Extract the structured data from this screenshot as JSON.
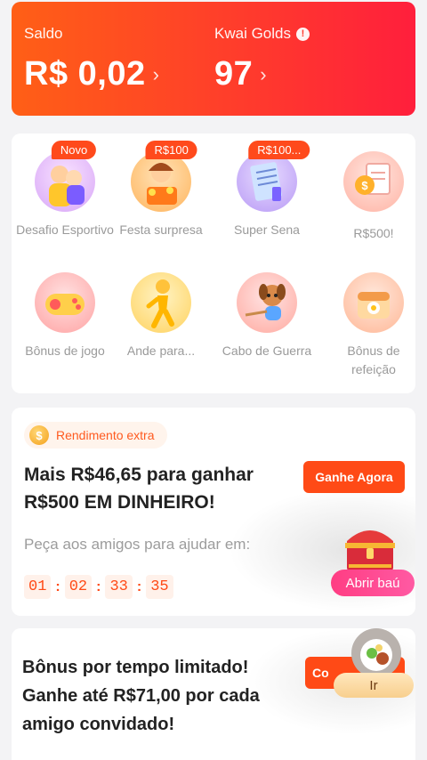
{
  "balance": {
    "saldo_label": "Saldo",
    "saldo_value": "R$ 0,02",
    "golds_label": "Kwai Golds",
    "golds_value": "97",
    "chevron": "›",
    "info_icon": "!"
  },
  "tiles": [
    {
      "badge": "Novo",
      "label": "Desafio Esportivo",
      "icon": "sport-challenge-icon"
    },
    {
      "badge": "R$100",
      "label": "Festa surpresa",
      "icon": "party-icon"
    },
    {
      "badge": "R$100...",
      "label": "Super Sena",
      "icon": "lottery-ticket-icon"
    },
    {
      "badge": "",
      "label": "R$500!",
      "icon": "coin-document-icon"
    },
    {
      "badge": "",
      "label": "Bônus de jogo",
      "icon": "gamepad-icon"
    },
    {
      "badge": "",
      "label": "Ande para...",
      "icon": "walking-person-icon"
    },
    {
      "badge": "",
      "label": "Cabo de Guerra",
      "icon": "tug-of-war-dog-icon"
    },
    {
      "badge": "",
      "label": "Bônus de refeição",
      "icon": "meal-plate-icon"
    }
  ],
  "rendimento": {
    "pill_label": "Rendimento extra",
    "coin_glyph": "$",
    "title": "Mais R$46,65 para ganhar R$500 EM DINHEIRO!",
    "button": "Ganhe Agora",
    "subtitle": "Peça aos amigos para ajudar em:",
    "timer": [
      "01",
      "02",
      "33",
      "35"
    ],
    "separator": ":",
    "chest_button": "Abrir baú"
  },
  "bonus": {
    "title": "Bônus por tempo limitado! Ganhe até R$71,00 por cada amigo convidado!",
    "button": "Co",
    "float_button": "Ir"
  },
  "colors": {
    "accent": "#ff4a16",
    "header_gradient_start": "#ff5f16",
    "header_gradient_end": "#ff1f3c",
    "chest_button": "#ff3d83"
  }
}
